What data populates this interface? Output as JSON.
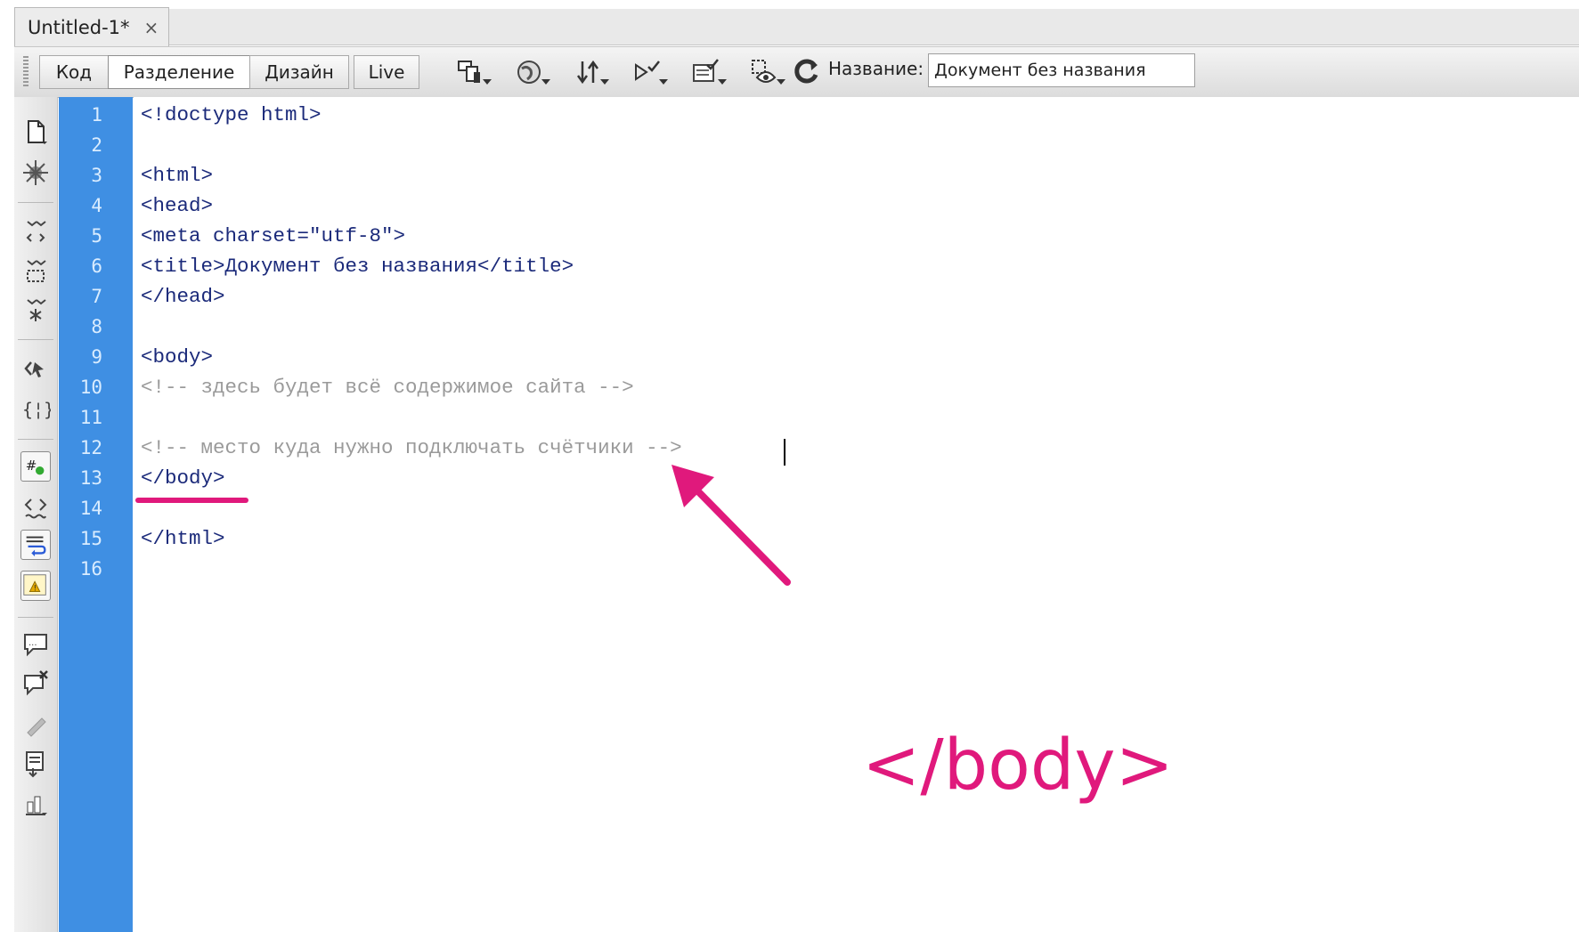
{
  "document_tab": {
    "label": "Untitled-1*",
    "close": "×"
  },
  "toolbar": {
    "view_buttons": [
      "Код",
      "Разделение",
      "Дизайн",
      "Live"
    ],
    "active_view": "Разделение",
    "icons": [
      "multiscreen-preview-icon",
      "preview-in-browser-icon",
      "file-management-icon",
      "w3c-validation-icon",
      "check-browser-compatibility-icon",
      "visual-aids-icon",
      "refresh-icon"
    ],
    "title_label": "Название:",
    "title_value": "Документ без названия"
  },
  "left_tools": [
    "open-documents-icon",
    "show-code-navigator-icon",
    "collapse-full-tag-icon",
    "collapse-selection-icon",
    "expand-all-icon",
    "select-parent-tag-icon",
    "balance-braces-icon",
    "line-numbers-icon",
    "highlight-invalid-code-icon",
    "word-wrap-icon",
    "syntax-error-alerts-icon",
    "apply-comment-icon",
    "remove-comment-icon",
    "wrap-tag-icon",
    "recent-snippets-icon",
    "move-css-icon"
  ],
  "editor": {
    "line_numbers": [
      "1",
      "2",
      "3",
      "4",
      "5",
      "6",
      "7",
      "8",
      "9",
      "10",
      "11",
      "12",
      "13",
      "14",
      "15",
      "16"
    ],
    "lines": [
      {
        "text": "<!doctype html>",
        "kind": "tag"
      },
      {
        "text": "",
        "kind": "tag"
      },
      {
        "text": "<html>",
        "kind": "tag"
      },
      {
        "text": "<head>",
        "kind": "tag"
      },
      {
        "text": "<meta charset=\"utf-8\">",
        "kind": "tag"
      },
      {
        "text": "<title>Документ без названия</title>",
        "kind": "tag"
      },
      {
        "text": "</head>",
        "kind": "tag"
      },
      {
        "text": "",
        "kind": "tag"
      },
      {
        "text": "<body>",
        "kind": "tag"
      },
      {
        "text": "<!-- здесь будет всё содержимое сайта -->",
        "kind": "comment"
      },
      {
        "text": "",
        "kind": "tag"
      },
      {
        "text": "<!-- место куда нужно подключать счётчики -->",
        "kind": "comment"
      },
      {
        "text": "</body>",
        "kind": "tag"
      },
      {
        "text": "",
        "kind": "tag"
      },
      {
        "text": "</html>",
        "kind": "tag"
      },
      {
        "text": "",
        "kind": "tag"
      }
    ]
  },
  "annotation": {
    "label": "</body>",
    "color": "#e0197c"
  },
  "colors": {
    "gutter": "#3f8fe3",
    "tag_text": "#1b2a7a",
    "comment_text": "#9a9a9a",
    "annotation": "#e0197c"
  }
}
